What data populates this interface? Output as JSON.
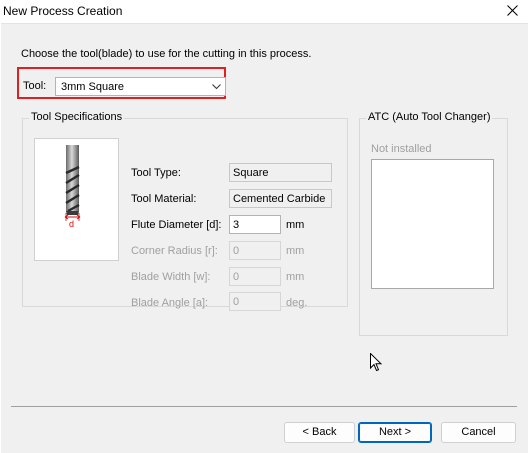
{
  "window": {
    "title": "New Process Creation"
  },
  "instruction": "Choose the tool(blade) to use for the cutting in this process.",
  "tool": {
    "label": "Tool:",
    "selected": "3mm Square"
  },
  "tool_specifications": {
    "legend": "Tool Specifications",
    "diagram_label": "d",
    "tool_type": {
      "label": "Tool Type:",
      "value": "Square"
    },
    "tool_material": {
      "label": "Tool Material:",
      "value": "Cemented Carbide"
    },
    "flute_diameter": {
      "label": "Flute Diameter [d]:",
      "value": "3",
      "unit": "mm"
    },
    "corner_radius": {
      "label": "Corner Radius [r]:",
      "value": "0",
      "unit": "mm"
    },
    "blade_width": {
      "label": "Blade Width [w]:",
      "value": "0",
      "unit": "mm"
    },
    "blade_angle": {
      "label": "Blade Angle [a]:",
      "value": "0",
      "unit": "deg."
    }
  },
  "atc": {
    "legend": "ATC (Auto Tool Changer)",
    "status": "Not installed"
  },
  "buttons": {
    "back": "< Back",
    "next": "Next >",
    "cancel": "Cancel"
  },
  "colors": {
    "highlight": "#e02020",
    "primary_border": "#0067c0",
    "dialog_bg": "#f0f0f0"
  },
  "icons": {
    "close": "close-icon",
    "dropdown": "chevron-down-icon",
    "tool_picture": "end-mill-icon",
    "cursor": "mouse-pointer-icon"
  }
}
